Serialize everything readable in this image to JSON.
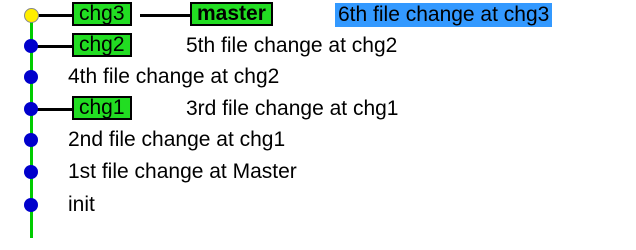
{
  "commits": [
    {
      "message": "6th file change at chg3",
      "refs": [
        "chg3",
        "master"
      ],
      "head": true,
      "selected": true
    },
    {
      "message": "5th file change at chg2",
      "refs": [
        "chg2"
      ]
    },
    {
      "message": "4th file change at chg2",
      "refs": []
    },
    {
      "message": "3rd file change at chg1",
      "refs": [
        "chg1"
      ]
    },
    {
      "message": "2nd file change at chg1",
      "refs": []
    },
    {
      "message": "1st file change at Master",
      "refs": []
    },
    {
      "message": "init",
      "refs": []
    }
  ],
  "colors": {
    "branch_line": "#00cc00",
    "commit_node": "#0000cc",
    "head_node": "#ffee00",
    "ref_label": "#22dd22",
    "selection": "#3399ff"
  }
}
